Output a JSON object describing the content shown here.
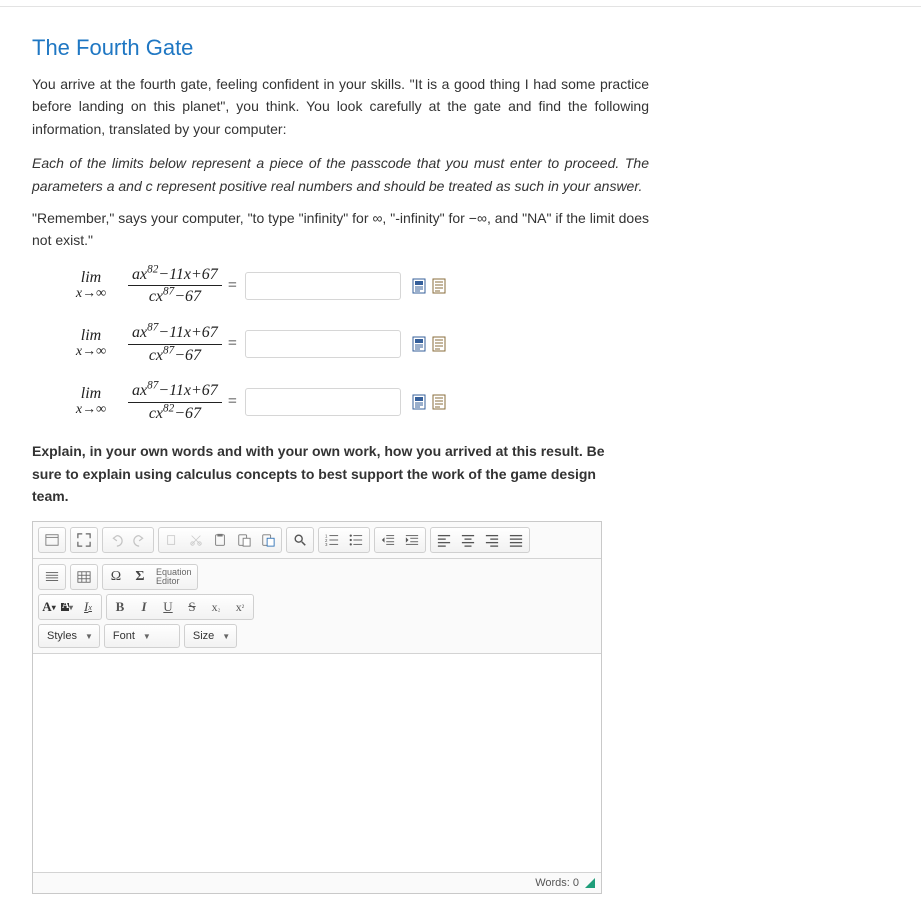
{
  "title": "The Fourth Gate",
  "intro": "You arrive at the fourth gate, feeling confident in your skills. \"It is a good thing I had some practice before landing on this planet\", you think. You look carefully at the gate and find the following information, translated by your computer:",
  "instruction": "Each of the limits below represent a piece of the passcode that you must enter to proceed. The parameters a and c represent positive real numbers and should be treated as such in your answer.",
  "remember": "\"Remember,\" says your computer, \"to type \"infinity\" for ∞, \"-infinity\" for −∞, and \"NA\" if the limit does not exist.\"",
  "limword": "lim",
  "limsub": "x→∞",
  "limits": [
    {
      "num_html": "ax<sup>82</sup>−11x+67",
      "den_html": "cx<sup>87</sup>−67",
      "answer": ""
    },
    {
      "num_html": "ax<sup>87</sup>−11x+67",
      "den_html": "cx<sup>87</sup>−67",
      "answer": ""
    },
    {
      "num_html": "ax<sup>87</sup>−11x+67",
      "den_html": "cx<sup>82</sup>−67",
      "answer": ""
    }
  ],
  "explain": "Explain, in your own words and with your own work, how you arrived at this result. Be sure to explain using calculus concepts to best support the work of the game design team.",
  "editor": {
    "eq_label": "Equation\nEditor",
    "styles": "Styles",
    "font": "Font",
    "size": "Size",
    "words_label": "Words: 0"
  }
}
